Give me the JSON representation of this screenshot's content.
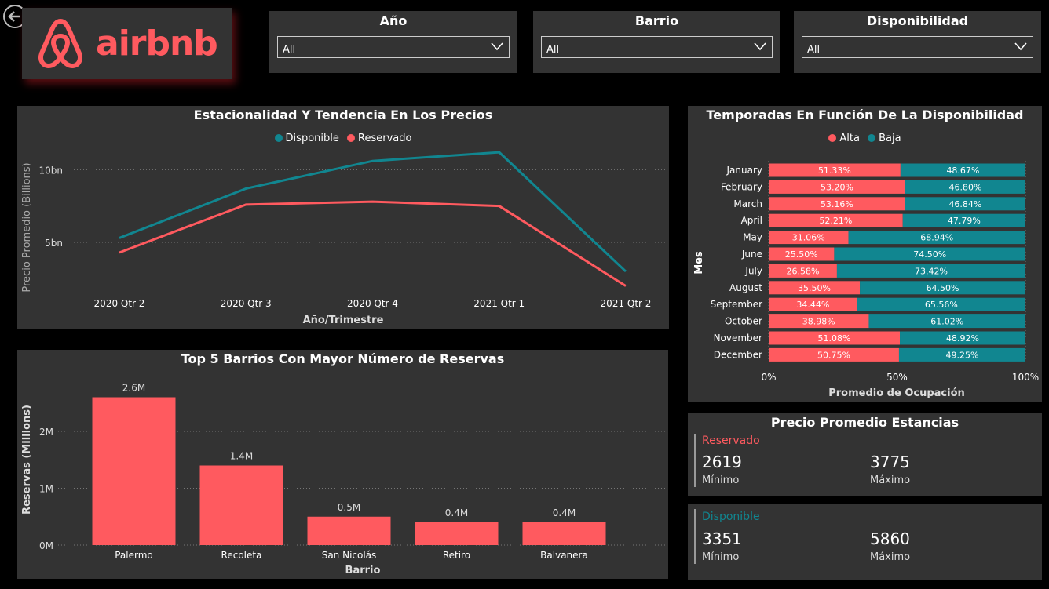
{
  "colors": {
    "accent": "#ff5a5f",
    "teal": "#118690",
    "panel": "#333333"
  },
  "logo": {
    "text": "airbnb"
  },
  "filters": [
    {
      "title": "Año",
      "value": "All"
    },
    {
      "title": "Barrio",
      "value": "All"
    },
    {
      "title": "Disponibilidad",
      "value": "All"
    }
  ],
  "line_chart": {
    "title": "Estacionalidad Y Tendencia En Los Precios",
    "xlabel": "Año/Trimestre",
    "ylabel": "Precio Promedio (Billions)",
    "ytick_labels": [
      "5bn",
      "10bn"
    ]
  },
  "bar_chart": {
    "title": "Top 5 Barrios Con Mayor Número de Reservas",
    "xlabel": "Barrio",
    "ylabel": "Reservas (Millions)",
    "ytick_labels": [
      "0M",
      "1M",
      "2M"
    ]
  },
  "stacked_chart": {
    "title": "Temporadas En Función De La Disponibilidad",
    "xlabel": "Promedio de Ocupación",
    "ylabel": "Mes",
    "xtick_labels": [
      "0%",
      "50%",
      "100%"
    ]
  },
  "kpi": {
    "title": "Precio Promedio Estancias",
    "reservado": {
      "label": "Reservado",
      "min": "2619",
      "max": "3775",
      "min_label": "Mínimo",
      "max_label": "Máximo"
    },
    "disponible": {
      "label": "Disponible",
      "min": "3351",
      "max": "5860",
      "min_label": "Mínimo",
      "max_label": "Máximo"
    }
  },
  "chart_data": [
    {
      "type": "line",
      "x": [
        "2020 Qtr 2",
        "2020 Qtr 3",
        "2020 Qtr 4",
        "2021 Qtr 1",
        "2021 Qtr 2"
      ],
      "series": [
        {
          "name": "Disponible",
          "color": "#118690",
          "values": [
            5.3,
            8.7,
            10.6,
            11.2,
            3.0
          ]
        },
        {
          "name": "Reservado",
          "color": "#ff5a5f",
          "values": [
            4.3,
            7.6,
            7.8,
            7.5,
            2.0
          ]
        }
      ],
      "ylim": [
        0.9,
        12.5
      ],
      "grid": true,
      "legend": "top-center"
    },
    {
      "type": "bar",
      "categories": [
        "Palermo",
        "Recoleta",
        "San Nicolás",
        "Retiro",
        "Balvanera"
      ],
      "values": [
        2.6,
        1.4,
        0.5,
        0.4,
        0.4
      ],
      "data_labels": [
        "2.6M",
        "1.4M",
        "0.5M",
        "0.4M",
        "0.4M"
      ],
      "ylim": [
        0,
        2.6
      ],
      "grid": true
    },
    {
      "type": "bar",
      "orientation": "horizontal-stacked-100",
      "categories": [
        "January",
        "February",
        "March",
        "April",
        "May",
        "June",
        "July",
        "August",
        "September",
        "October",
        "November",
        "December"
      ],
      "series": [
        {
          "name": "Alta",
          "color": "#ff5a5f",
          "values": [
            51.33,
            53.2,
            53.16,
            52.21,
            31.06,
            25.5,
            26.58,
            35.5,
            34.44,
            38.98,
            51.08,
            50.75
          ],
          "labels": [
            "51.33%",
            "53.20%",
            "53.16%",
            "52.21%",
            "31.06%",
            "25.50%",
            "26.58%",
            "35.50%",
            "34.44%",
            "38.98%",
            "51.08%",
            "50.75%"
          ]
        },
        {
          "name": "Baja",
          "color": "#118690",
          "values": [
            48.67,
            46.8,
            46.84,
            47.79,
            68.94,
            74.5,
            73.42,
            64.5,
            65.56,
            61.02,
            48.92,
            49.25
          ],
          "labels": [
            "48.67%",
            "46.80%",
            "46.84%",
            "47.79%",
            "68.94%",
            "74.50%",
            "73.42%",
            "64.50%",
            "65.56%",
            "61.02%",
            "48.92%",
            "49.25%"
          ]
        }
      ],
      "xlim": [
        0,
        100
      ],
      "legend": "top-center"
    }
  ]
}
